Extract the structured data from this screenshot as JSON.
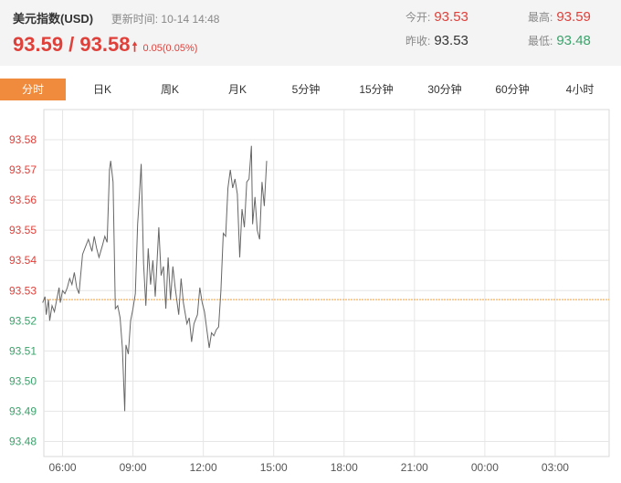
{
  "header": {
    "title": "美元指数(USD)",
    "update_label": "更新时间:",
    "update_time": "10-14 14:48",
    "price": "93.59 / 93.58",
    "change": "0.05(0.05%)",
    "open_label": "今开:",
    "open_value": "93.53",
    "prev_close_label": "昨收:",
    "prev_close_value": "93.53",
    "high_label": "最高:",
    "high_value": "93.59",
    "low_label": "最低:",
    "low_value": "93.48",
    "up_color": "#e0403a",
    "down_color": "#3aa36b"
  },
  "tabs": [
    {
      "label": "分时",
      "active": true
    },
    {
      "label": "日K",
      "active": false
    },
    {
      "label": "周K",
      "active": false
    },
    {
      "label": "月K",
      "active": false
    },
    {
      "label": "5分钟",
      "active": false
    },
    {
      "label": "15分钟",
      "active": false
    },
    {
      "label": "30分钟",
      "active": false
    },
    {
      "label": "60分钟",
      "active": false
    },
    {
      "label": "4小时",
      "active": false
    }
  ],
  "chart_data": {
    "type": "line",
    "x_unit": "hours",
    "x_ticks": [
      {
        "label": "06:00",
        "value": 0
      },
      {
        "label": "09:00",
        "value": 3
      },
      {
        "label": "12:00",
        "value": 6
      },
      {
        "label": "15:00",
        "value": 9
      },
      {
        "label": "18:00",
        "value": 12
      },
      {
        "label": "21:00",
        "value": 15
      },
      {
        "label": "00:00",
        "value": 18
      },
      {
        "label": "03:00",
        "value": 21
      }
    ],
    "xlim": [
      -0.8,
      23.3
    ],
    "ylim": [
      93.475,
      93.59
    ],
    "y_ticks": [
      "93.58",
      "93.57",
      "93.56",
      "93.55",
      "93.54",
      "93.53",
      "93.52",
      "93.51",
      "93.50",
      "93.49",
      "93.48"
    ],
    "reference_line": 93.527,
    "line_color": "#666666",
    "reference_color": "#f39c3c",
    "grid": true,
    "series": [
      {
        "values": [
          [
            -0.85,
            93.526
          ],
          [
            -0.75,
            93.528
          ],
          [
            -0.7,
            93.522
          ],
          [
            -0.6,
            93.527
          ],
          [
            -0.55,
            93.52
          ],
          [
            -0.45,
            93.525
          ],
          [
            -0.35,
            93.523
          ],
          [
            -0.25,
            93.527
          ],
          [
            -0.15,
            93.531
          ],
          [
            -0.1,
            93.526
          ],
          [
            0.0,
            93.53
          ],
          [
            0.1,
            93.529
          ],
          [
            0.2,
            93.531
          ],
          [
            0.3,
            93.534
          ],
          [
            0.4,
            93.532
          ],
          [
            0.5,
            93.536
          ],
          [
            0.6,
            93.531
          ],
          [
            0.7,
            93.529
          ],
          [
            0.85,
            93.542
          ],
          [
            1.0,
            93.545
          ],
          [
            1.1,
            93.547
          ],
          [
            1.25,
            93.543
          ],
          [
            1.35,
            93.548
          ],
          [
            1.45,
            93.544
          ],
          [
            1.55,
            93.541
          ],
          [
            1.7,
            93.545
          ],
          [
            1.8,
            93.548
          ],
          [
            1.9,
            93.546
          ],
          [
            2.0,
            93.57
          ],
          [
            2.05,
            93.573
          ],
          [
            2.15,
            93.566
          ],
          [
            2.25,
            93.524
          ],
          [
            2.35,
            93.525
          ],
          [
            2.45,
            93.521
          ],
          [
            2.55,
            93.511
          ],
          [
            2.65,
            93.49
          ],
          [
            2.7,
            93.512
          ],
          [
            2.8,
            93.509
          ],
          [
            2.9,
            93.52
          ],
          [
            3.0,
            93.524
          ],
          [
            3.1,
            93.529
          ],
          [
            3.2,
            93.552
          ],
          [
            3.25,
            93.558
          ],
          [
            3.35,
            93.572
          ],
          [
            3.45,
            93.539
          ],
          [
            3.55,
            93.525
          ],
          [
            3.65,
            93.544
          ],
          [
            3.75,
            93.532
          ],
          [
            3.85,
            93.54
          ],
          [
            3.95,
            93.528
          ],
          [
            4.1,
            93.551
          ],
          [
            4.2,
            93.535
          ],
          [
            4.3,
            93.538
          ],
          [
            4.4,
            93.524
          ],
          [
            4.5,
            93.541
          ],
          [
            4.6,
            93.527
          ],
          [
            4.7,
            93.538
          ],
          [
            4.8,
            93.531
          ],
          [
            4.95,
            93.522
          ],
          [
            5.05,
            93.534
          ],
          [
            5.15,
            93.526
          ],
          [
            5.3,
            93.519
          ],
          [
            5.4,
            93.521
          ],
          [
            5.5,
            93.513
          ],
          [
            5.6,
            93.519
          ],
          [
            5.75,
            93.522
          ],
          [
            5.85,
            93.531
          ],
          [
            5.95,
            93.526
          ],
          [
            6.05,
            93.523
          ],
          [
            6.15,
            93.517
          ],
          [
            6.25,
            93.511
          ],
          [
            6.35,
            93.516
          ],
          [
            6.45,
            93.515
          ],
          [
            6.55,
            93.517
          ],
          [
            6.65,
            93.518
          ],
          [
            6.75,
            93.53
          ],
          [
            6.85,
            93.549
          ],
          [
            6.95,
            93.548
          ],
          [
            7.05,
            93.564
          ],
          [
            7.15,
            93.57
          ],
          [
            7.25,
            93.564
          ],
          [
            7.35,
            93.567
          ],
          [
            7.45,
            93.562
          ],
          [
            7.55,
            93.541
          ],
          [
            7.65,
            93.557
          ],
          [
            7.75,
            93.551
          ],
          [
            7.85,
            93.566
          ],
          [
            7.95,
            93.567
          ],
          [
            8.05,
            93.578
          ],
          [
            8.1,
            93.552
          ],
          [
            8.2,
            93.561
          ],
          [
            8.3,
            93.55
          ],
          [
            8.4,
            93.547
          ],
          [
            8.5,
            93.566
          ],
          [
            8.6,
            93.558
          ],
          [
            8.7,
            93.573
          ]
        ]
      }
    ]
  }
}
